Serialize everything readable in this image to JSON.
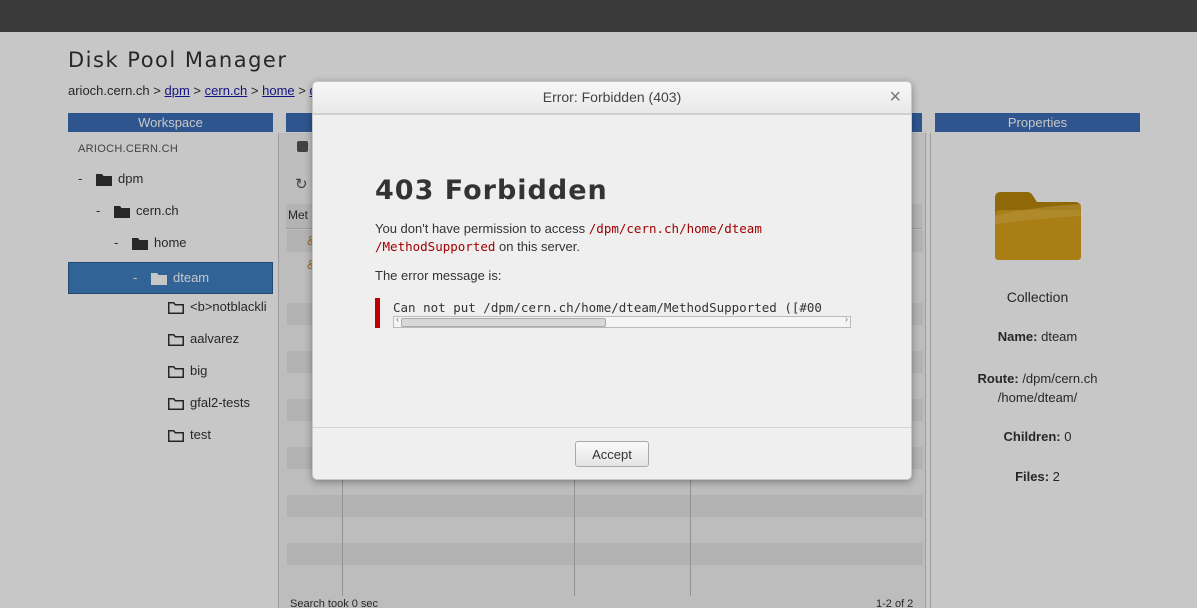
{
  "app": {
    "title": "Disk Pool Manager"
  },
  "breadcrumb": {
    "host": "arioch.cern.ch",
    "sep": ">",
    "links": [
      "dpm",
      "cern.ch",
      "home",
      "d"
    ]
  },
  "workspace": {
    "header": "Workspace",
    "host_label": "ARIOCH.CERN.CH",
    "tree": [
      {
        "label": "dpm",
        "expand": "-"
      },
      {
        "label": "cern.ch",
        "expand": "-"
      },
      {
        "label": "home",
        "expand": "-"
      },
      {
        "label": "dteam",
        "expand": "-"
      },
      {
        "label": "<b>notblackli"
      },
      {
        "label": "aalvarez"
      },
      {
        "label": "big"
      },
      {
        "label": "gfal2-tests"
      },
      {
        "label": "test"
      }
    ]
  },
  "grid": {
    "col_header": "Met",
    "status_left": "Search took 0 sec",
    "status_right": "1-2 of 2"
  },
  "properties": {
    "header": "Properties",
    "type": "Collection",
    "name_label": "Name:",
    "name_value": "dteam",
    "route_label": "Route:",
    "route_value_1": "/dpm/cern.ch",
    "route_value_2": "/home/dteam/",
    "children_label": "Children:",
    "children_value": "0",
    "files_label": "Files:",
    "files_value": "2"
  },
  "dialog": {
    "title": "Error: Forbidden (403)",
    "close_glyph": "×",
    "heading": "403 Forbidden",
    "desc_pre": "You don't have permission to access",
    "path_1": "/dpm/cern.ch/home/dteam",
    "path_2": "/MethodSupported",
    "desc_post": "on this server.",
    "msg_label": "The error message is:",
    "error_message": "Can not put /dpm/cern.ch/home/dteam/MethodSupported ([#00",
    "accept_label": "Accept"
  }
}
